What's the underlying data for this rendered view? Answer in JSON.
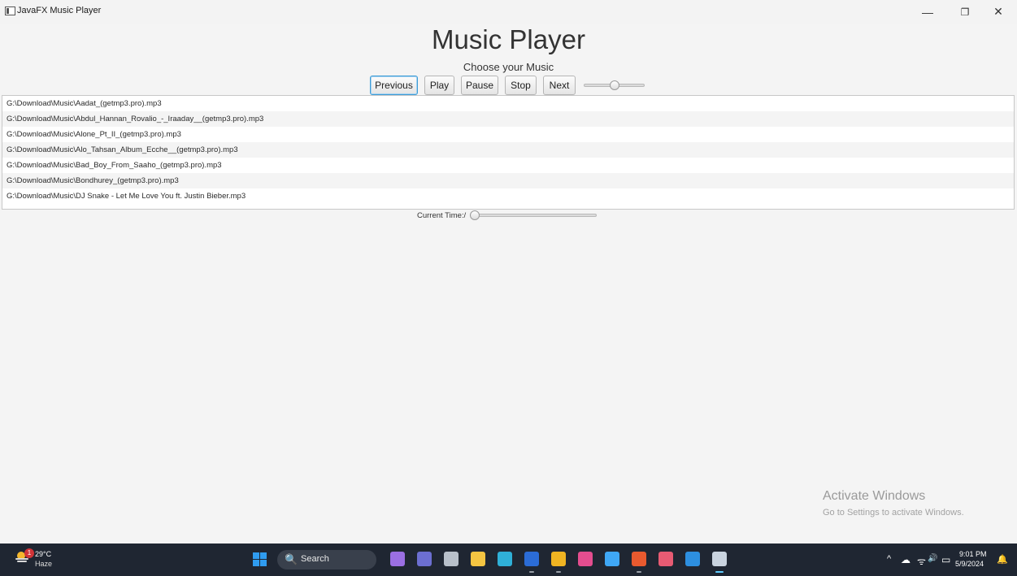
{
  "window": {
    "title": "JavaFX Music Player",
    "minimize_glyph": "—",
    "restore_glyph": "❐",
    "close_glyph": "✕"
  },
  "app": {
    "title": "Music Player",
    "subtitle": "Choose your Music",
    "buttons": {
      "previous": "Previous",
      "play": "Play",
      "pause": "Pause",
      "stop": "Stop",
      "next": "Next"
    },
    "volume_level": 0.5,
    "playlist": [
      "G:\\Download\\Music\\Aadat_(getmp3.pro).mp3",
      "G:\\Download\\Music\\Abdul_Hannan_Rovalio_-_Iraaday__(getmp3.pro).mp3",
      "G:\\Download\\Music\\Alone_Pt_II_(getmp3.pro).mp3",
      "G:\\Download\\Music\\Alo_Tahsan_Album_Ecche__(getmp3.pro).mp3",
      "G:\\Download\\Music\\Bad_Boy_From_Saaho_(getmp3.pro).mp3",
      "G:\\Download\\Music\\Bondhurey_(getmp3.pro).mp3",
      "G:\\Download\\Music\\DJ Snake - Let Me Love You ft. Justin Bieber.mp3"
    ],
    "current_time_label": "Current Time:/",
    "progress_level": 0.0
  },
  "watermark": {
    "line1": "Activate Windows",
    "line2": "Go to Settings to activate Windows."
  },
  "taskbar": {
    "weather": {
      "temperature": "29°C",
      "condition": "Haze",
      "badge": "1"
    },
    "search_label": "Search",
    "search_glyph": "🔍",
    "clock": {
      "time": "9:01 PM",
      "date": "5/9/2024"
    },
    "tray_glyphs": {
      "chevron": "^",
      "cloud": "☁",
      "wifi": "ᯤ",
      "volume": "🔊",
      "battery": "▭",
      "bell": "🔔"
    },
    "apps": [
      {
        "name": "copilot",
        "color": "#9b6fe3"
      },
      {
        "name": "teams",
        "color": "#6c6fd1"
      },
      {
        "name": "terminal",
        "color": "#b8c0ca"
      },
      {
        "name": "file-explorer",
        "color": "#f5c542"
      },
      {
        "name": "edge",
        "color": "#2fb0d8"
      },
      {
        "name": "word",
        "color": "#2b6cd6"
      },
      {
        "name": "chrome",
        "color": "#f0b422"
      },
      {
        "name": "intellij",
        "color": "#e44d8f"
      },
      {
        "name": "app-cube",
        "color": "#3fa7f5"
      },
      {
        "name": "store",
        "color": "#e95a2f"
      },
      {
        "name": "xampp",
        "color": "#e75b73"
      },
      {
        "name": "vscode",
        "color": "#2d8fe0"
      },
      {
        "name": "java",
        "color": "#c9d3df"
      }
    ]
  }
}
